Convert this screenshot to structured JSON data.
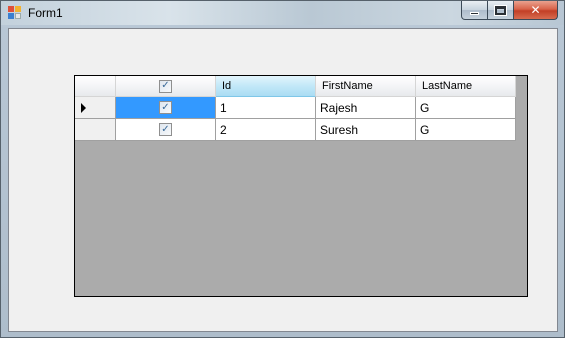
{
  "window": {
    "title": "Form1",
    "close_glyph": "✕"
  },
  "grid": {
    "columns": [
      {
        "key": "select",
        "label": "",
        "type": "checkbox",
        "checked": true
      },
      {
        "key": "id",
        "label": "Id"
      },
      {
        "key": "first_name",
        "label": "FirstName"
      },
      {
        "key": "last_name",
        "label": "LastName"
      }
    ],
    "sorted_column": "Id",
    "rows": [
      {
        "checked": true,
        "id": "1",
        "first_name": "Rajesh",
        "last_name": "G",
        "current": true
      },
      {
        "checked": true,
        "id": "2",
        "first_name": "Suresh",
        "last_name": "G",
        "current": false
      }
    ],
    "check_glyph": "✓"
  }
}
